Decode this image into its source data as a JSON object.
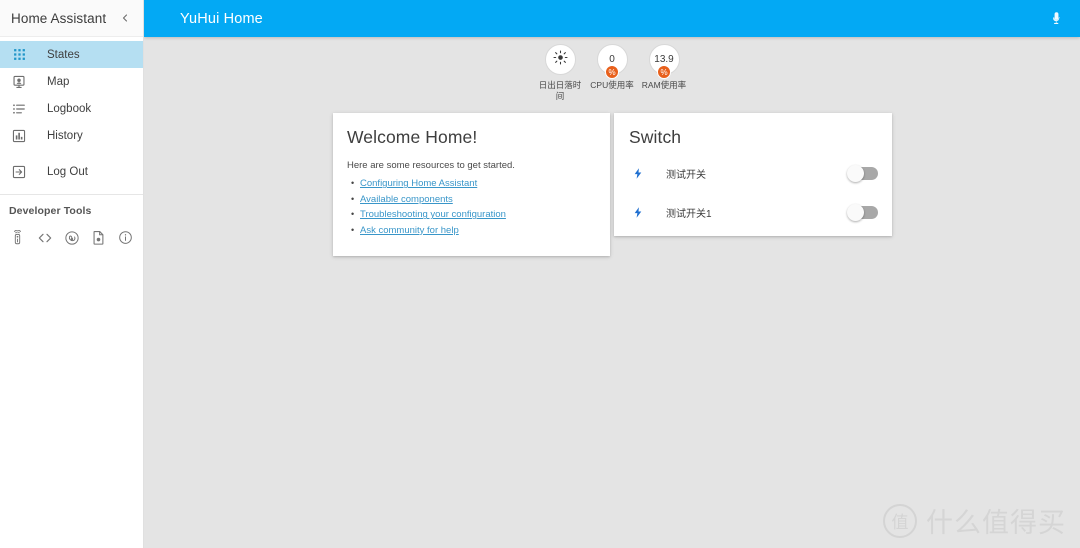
{
  "sidebar": {
    "title": "Home Assistant",
    "collapse_icon": "chevron-left-icon",
    "items": [
      {
        "label": "States",
        "icon": "grid-icon",
        "active": true
      },
      {
        "label": "Map",
        "icon": "map-marker-icon",
        "active": false
      },
      {
        "label": "Logbook",
        "icon": "list-icon",
        "active": false
      },
      {
        "label": "History",
        "icon": "bar-chart-icon",
        "active": false
      },
      {
        "label": "Log Out",
        "icon": "exit-icon",
        "active": false
      }
    ],
    "developer_tools": {
      "title": "Developer Tools",
      "icons": [
        {
          "name": "remote-icon"
        },
        {
          "name": "code-brackets-icon"
        },
        {
          "name": "broadcast-icon"
        },
        {
          "name": "template-file-icon"
        },
        {
          "name": "info-icon"
        }
      ]
    }
  },
  "toolbar": {
    "title": "YuHui Home",
    "mic_icon": "microphone-icon",
    "accent_color": "#03A9F4"
  },
  "badges": [
    {
      "type": "icon",
      "icon": "sun-icon",
      "value": "",
      "unit": "",
      "label": "日出日落时间"
    },
    {
      "type": "value",
      "icon": "",
      "value": "0",
      "unit": "%",
      "label": "CPU使用率"
    },
    {
      "type": "value",
      "icon": "",
      "value": "13.9",
      "unit": "%",
      "label": "RAM使用率"
    }
  ],
  "cards": {
    "welcome": {
      "title": "Welcome Home!",
      "subtitle": "Here are some resources to get started.",
      "links": [
        "Configuring Home Assistant",
        "Available components",
        "Troubleshooting your configuration",
        "Ask community for help"
      ],
      "link_color": "#3996C9"
    },
    "switch": {
      "title": "Switch",
      "rows": [
        {
          "name": "测试开关",
          "icon": "lightning-bolt-icon",
          "state": "off"
        },
        {
          "name": "测试开关1",
          "icon": "lightning-bolt-icon",
          "state": "off"
        }
      ]
    }
  },
  "watermark": {
    "logo_text": "值",
    "text": "什么值得买"
  }
}
